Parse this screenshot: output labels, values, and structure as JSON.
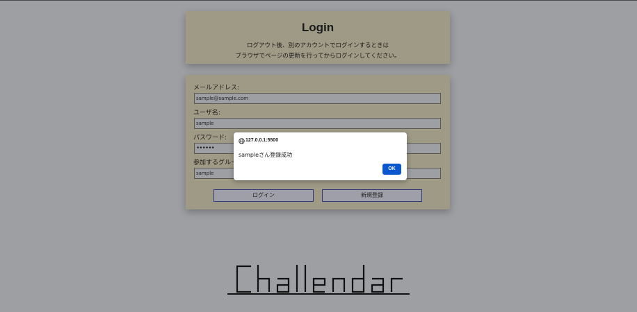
{
  "login_card": {
    "title": "Login",
    "message_line1": "ログアウト後、別のアカウントでログインするときは",
    "message_line2": "ブラウザでページの更新を行ってからログインしてください。"
  },
  "form": {
    "email_label": "メールアドレス:",
    "email_value": "sample@sample.com",
    "username_label": "ユーザ名:",
    "username_value": "sample",
    "password_label": "パスワード:",
    "password_value": "••••••",
    "group_label": "参加するグループ",
    "group_value": "sample",
    "login_button": "ログイン",
    "register_button": "新規登録"
  },
  "alert": {
    "origin": "127.0.0.1:5500",
    "message": "sampleさん登録成功",
    "ok_label": "OK"
  },
  "logo": {
    "text": "Challendar"
  },
  "colors": {
    "overlay_background": "#9e9fa3",
    "card": "#9f9a86",
    "ok_button": "#0b57d0"
  }
}
